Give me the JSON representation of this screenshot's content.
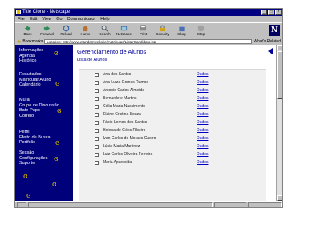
{
  "window": {
    "title": "Title Clone - Netscape"
  },
  "menu": [
    "File",
    "Edit",
    "View",
    "Go",
    "Communicator",
    "Help"
  ],
  "toolbar": [
    {
      "label": "Back",
      "icon": "back-arrow-icon"
    },
    {
      "label": "Forward",
      "icon": "forward-arrow-icon"
    },
    {
      "label": "Reload",
      "icon": "reload-icon"
    },
    {
      "label": "Home",
      "icon": "home-icon"
    },
    {
      "label": "Search",
      "icon": "search-icon"
    },
    {
      "label": "Netscape",
      "icon": "netscape-icon"
    },
    {
      "label": "Print",
      "icon": "print-icon"
    },
    {
      "label": "Security",
      "icon": "security-lock-icon"
    },
    {
      "label": "Shop",
      "icon": "shop-icon"
    },
    {
      "label": "Stop",
      "icon": "stop-icon"
    }
  ],
  "brand": "N",
  "location": {
    "label": "Bookmarks",
    "url": "Location: http://www.etandemwebsite/matriculas/ListarCandidato.jsp",
    "related": "What's Related"
  },
  "sidebar": {
    "groups": [
      [
        "Informações",
        "Agenda",
        "Histórico"
      ],
      [
        "Resultados",
        "Matricular Aluno",
        "Calendário"
      ],
      [
        "Mural",
        "Grupo de Discussão",
        "Bate-Papo",
        "Correio"
      ],
      [
        "Perfil",
        "Efeito de Busca",
        "Portfólio"
      ],
      [
        "Sessão",
        "Configurações",
        "Suporte"
      ]
    ]
  },
  "main": {
    "title": "Gerenciamento de Alunos",
    "subtitle": "Lista de Alunos",
    "students": [
      {
        "name": "Ana dos Santos",
        "link": "Dados"
      },
      {
        "name": "Ana Luiza Gomes Ramos",
        "link": "Dados"
      },
      {
        "name": "Antonio Carlos Almeida",
        "link": "Dados"
      },
      {
        "name": "Bernardete Martins",
        "link": "Dados"
      },
      {
        "name": "Célia Maria Nascimento",
        "link": "Dados"
      },
      {
        "name": "Elaine Cristina Souza",
        "link": "Dados"
      },
      {
        "name": "Fábio Lemos dos Santos",
        "link": "Dados"
      },
      {
        "name": "Helena de Góes Ribeiro",
        "link": "Dados"
      },
      {
        "name": "Ivan Carlos de Moraes Castro",
        "link": "Dados"
      },
      {
        "name": "Lúcia Maria Martinez",
        "link": "Dados"
      },
      {
        "name": "Luiz Carlos Oliveira Ferreira",
        "link": "Dados"
      },
      {
        "name": "Maria Aparecida",
        "link": "Dados"
      }
    ]
  },
  "colors": {
    "sidebar": "#00007a",
    "title": "#000099",
    "accent_swirl": "#d8b800",
    "link": "#0000cc"
  }
}
